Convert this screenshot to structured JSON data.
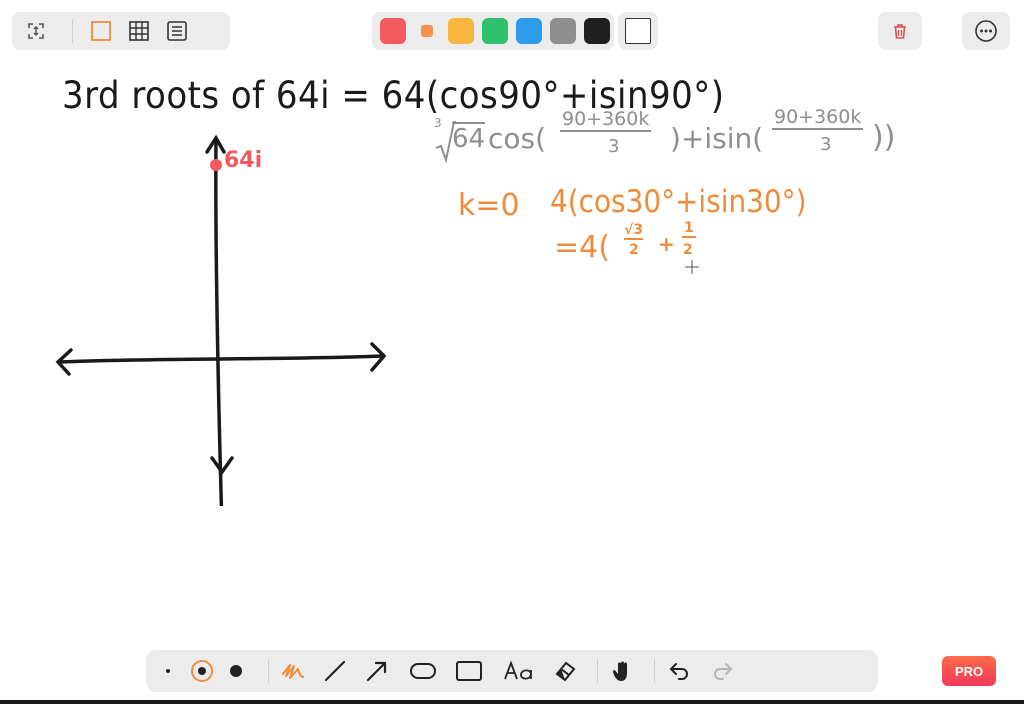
{
  "toolbar": {
    "colors": [
      "#f25a5f",
      "#f7904d",
      "#f8b63e",
      "#2dc26b",
      "#2e9bea",
      "#8e8e8e",
      "#1f1f1f"
    ],
    "selected_color": "#f7904d",
    "accent": "#ef8c3a",
    "trash_color": "#e05050"
  },
  "board": {
    "title": "3rd roots of 64i = 64(cos90°+isin90°)",
    "axis_label": "64i",
    "formula_root": "3",
    "formula_radicand": "64",
    "formula_cos": "cos(",
    "formula_num1": "90+360k",
    "formula_den1": "3",
    "formula_isin": ")+isin(",
    "formula_num2": "90+360k",
    "formula_den2": "3",
    "formula_close": "))",
    "k_label": "k=0",
    "k_expr": "4(cos30°+isin30°)",
    "eq_prefix": "=4(",
    "sqrt3": "√3",
    "two1": "2",
    "plus": "+",
    "one": "1",
    "two2": "2"
  },
  "badge": {
    "pro_label": "PRO"
  }
}
